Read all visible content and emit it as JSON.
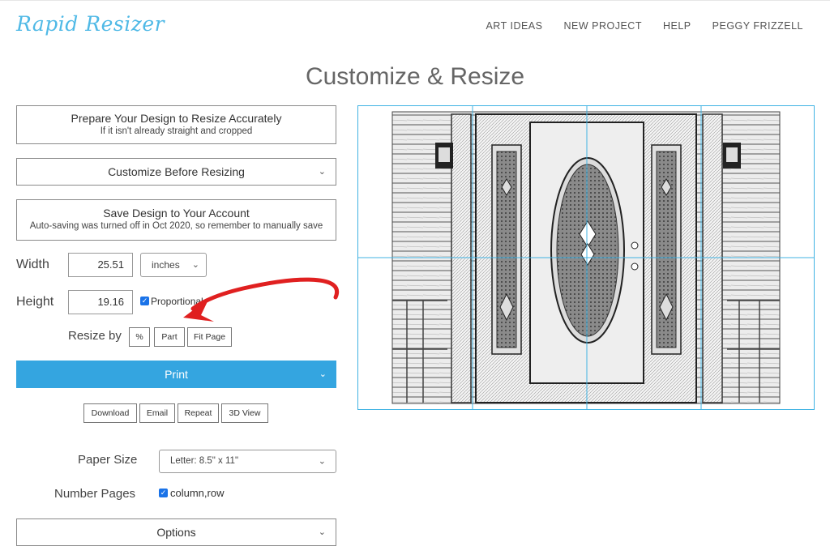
{
  "header": {
    "logo": "Rapid Resizer",
    "nav": [
      "ART IDEAS",
      "NEW PROJECT",
      "HELP",
      "PEGGY FRIZZELL"
    ]
  },
  "page_title": "Customize & Resize",
  "prepare": {
    "title": "Prepare Your Design to Resize Accurately",
    "subtitle": "If it isn't already straight and cropped"
  },
  "customize": {
    "label": "Customize Before Resizing"
  },
  "save": {
    "title": "Save Design to Your Account",
    "subtitle": "Auto-saving was turned off in Oct 2020, so remember to manually save"
  },
  "width": {
    "label": "Width",
    "value": "25.51",
    "unit": "inches"
  },
  "height": {
    "label": "Height",
    "value": "19.16",
    "proportional_label": "Proportional"
  },
  "resize_by": {
    "label": "Resize by",
    "buttons": [
      "%",
      "Part",
      "Fit Page"
    ]
  },
  "print": {
    "label": "Print"
  },
  "actions": [
    "Download",
    "Email",
    "Repeat",
    "3D View"
  ],
  "paper_size": {
    "label": "Paper Size",
    "value": "Letter: 8.5\" x 11\""
  },
  "number_pages": {
    "label": "Number Pages",
    "value": "column,row"
  },
  "options": {
    "label": "Options"
  },
  "preview": {
    "grid_columns": 4,
    "grid_rows": 2
  },
  "colors": {
    "accent": "#34a5e0",
    "grid": "#40b3e3",
    "arrow": "#e02020"
  }
}
